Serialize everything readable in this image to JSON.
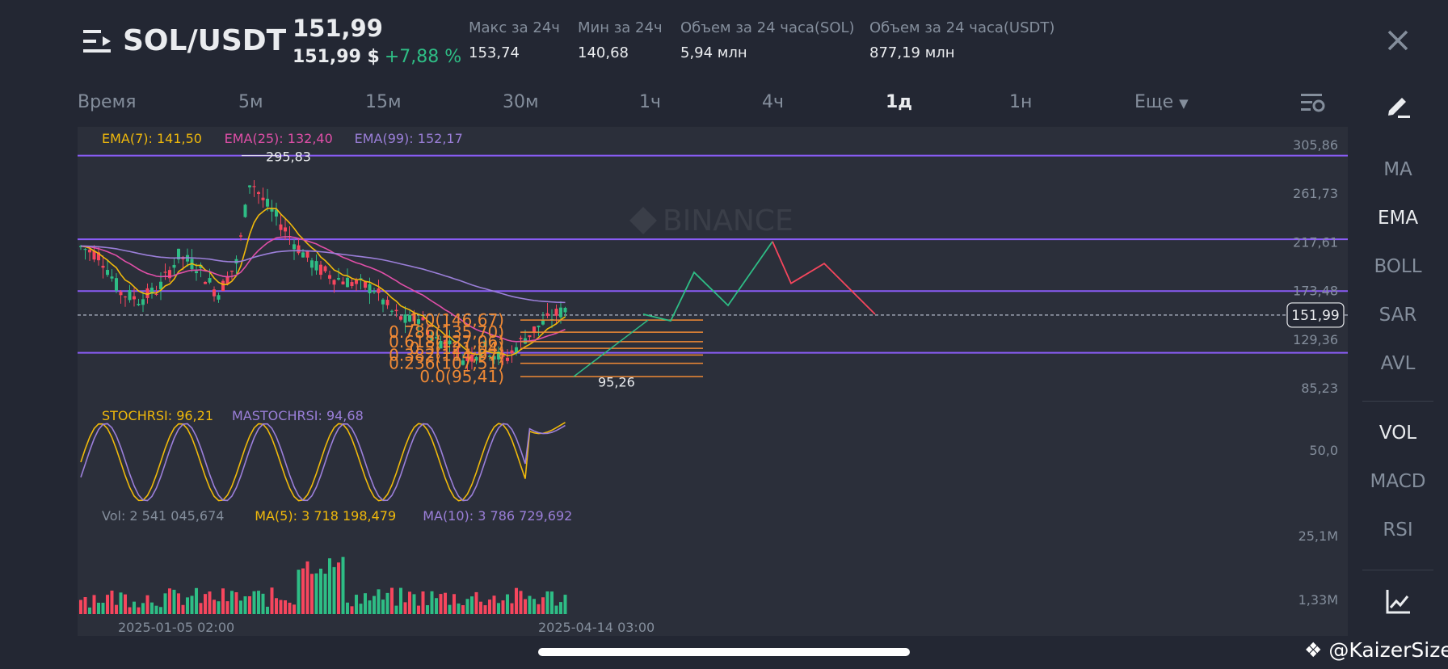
{
  "header": {
    "pair": "SOL/USDT",
    "last_price": "151,99",
    "price_usd": "151,99 $",
    "change": "+7,88 %",
    "stats": [
      {
        "label": "Макс за 24ч",
        "value": "153,74"
      },
      {
        "label": "Мин за 24ч",
        "value": "140,68"
      },
      {
        "label": "Объем за 24 часа(SOL)",
        "value": "5,94 млн"
      },
      {
        "label": "Объем за 24 часа(USDT)",
        "value": "877,19 млн"
      }
    ]
  },
  "timeframes": {
    "time_label": "Время",
    "items": [
      "5м",
      "15м",
      "30м",
      "1ч",
      "4ч",
      "1д",
      "1н"
    ],
    "active": "1д",
    "more": "Еще"
  },
  "sidebar": {
    "overlays": [
      "MA",
      "EMA",
      "BOLL",
      "SAR",
      "AVL"
    ],
    "active_overlay": "EMA",
    "panes": [
      "VOL",
      "MACD",
      "RSI"
    ],
    "active_pane": "VOL"
  },
  "chart": {
    "ema_legend": [
      {
        "text": "EMA(7): 141,50",
        "color": "#f0b90b"
      },
      {
        "text": "EMA(25): 132,40",
        "color": "#e04fa8"
      },
      {
        "text": "EMA(99): 152,17",
        "color": "#9b7fd9"
      }
    ],
    "price_axis": [
      "305,86",
      "261,73",
      "217,61",
      "173,48",
      "129,36",
      "85,23"
    ],
    "current_price_tag": "151,99",
    "high_marker": "295,83",
    "low_marker": "95,26",
    "watermark_logo": "BINANCE",
    "fib_labels": [
      "1.0(146,67)",
      "0.786(135,70)",
      "0.618(127,06)",
      "0.5(121,04)",
      "0.382(114,97)",
      "0.236(107,51)",
      "0.0(95,41)"
    ],
    "stoch_legend": [
      {
        "text": "STOCHRSI: 96,21",
        "color": "#f0b90b"
      },
      {
        "text": "MASTOCHRSI: 94,68",
        "color": "#9b7fd9"
      }
    ],
    "stoch_axis": "50,0",
    "vol_legend": [
      {
        "text": "Vol: 2 541 045,674",
        "color": "#848e9c"
      },
      {
        "text": "MA(5): 3 718 198,479",
        "color": "#f0b90b"
      },
      {
        "text": "MA(10): 3 786 729,692",
        "color": "#9b7fd9"
      }
    ],
    "vol_axis": [
      "25,1M",
      "1,33M"
    ],
    "date_labels": [
      "2025-01-05 02:00",
      "2025-04-14 03:00"
    ],
    "colors": {
      "up": "#2ebd85",
      "down": "#f6465d",
      "horizontal": "#8a5cf6",
      "fib": "#f08a35",
      "forecast_up": "#2ebd85",
      "forecast_down": "#f6465d"
    }
  },
  "chart_data": {
    "type": "candlestick",
    "y_axis_ticks": [
      305.86,
      261.73,
      217.61,
      173.48,
      129.36,
      85.23
    ],
    "horizontal_levels": [
      295.83,
      220.0,
      173.0,
      151.99,
      117.0
    ],
    "current_price": 151.99,
    "period_high": 295.83,
    "period_low": 95.26,
    "ema": {
      "EMA(7)": 141.5,
      "EMA(25)": 132.4,
      "EMA(99)": 152.17
    },
    "fibonacci": [
      {
        "level": "1.0",
        "price": 146.67
      },
      {
        "level": "0.786",
        "price": 135.7
      },
      {
        "level": "0.618",
        "price": 127.06
      },
      {
        "level": "0.5",
        "price": 121.04
      },
      {
        "level": "0.382",
        "price": 114.97
      },
      {
        "level": "0.236",
        "price": 107.51
      },
      {
        "level": "0.0",
        "price": 95.41
      }
    ],
    "forecast_path": [
      152,
      190,
      160,
      218,
      180,
      198,
      152
    ],
    "stochrsi": 96.21,
    "mastochrsi": 94.68,
    "volume": {
      "vol": "2 541 045,674",
      "ma5": "3 718 198,479",
      "ma10": "3 786 729,692"
    },
    "x_labels": [
      "2025-01-05 02:00",
      "2025-04-14 03:00"
    ]
  },
  "footer": {
    "watermark": "@KaizerSize"
  }
}
